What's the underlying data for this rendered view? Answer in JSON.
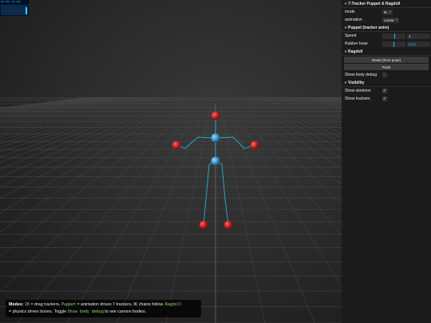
{
  "stats": {
    "text": "60 FPS (41-60)"
  },
  "gui": {
    "title": "7-Tracker Puppet & Ragdoll",
    "mode": {
      "label": "mode",
      "value": "IK"
    },
    "animation": {
      "label": "animation",
      "value": "Linear"
    },
    "puppet_section": {
      "title": "Puppet (tracker anim)"
    },
    "speed": {
      "label": "Speed",
      "value": "1",
      "level": 0.5
    },
    "rubber_hose": {
      "label": "Rubber hose",
      "value": "0.22",
      "level": 0.48
    },
    "ragdoll_section": {
      "title": "Ragdoll"
    },
    "reset_button": "Reset (from pose)",
    "push_button": "Push",
    "show_body_debug": {
      "label": "Show body debug",
      "checked": false
    },
    "visibility_section": {
      "title": "Visibility"
    },
    "show_skeleton": {
      "label": "Show skeleton",
      "checked": true
    },
    "show_trackers": {
      "label": "Show trackers",
      "checked": true
    }
  },
  "info": {
    "modes_label": "Modes:",
    "ik_code": "IK",
    "ik_text": " = drag trackers. ",
    "puppet_code": "Puppet",
    "puppet_text": " = animation drives 7 trackers, IK chains follow. ",
    "ragdoll_code": "Ragdoll",
    "ragdoll_text": "= physics drives bones. Toggle ",
    "debug_code": "Show body debug",
    "debug_text": " to see cannon bodies."
  },
  "colors": {
    "tracker": "#d42a2a",
    "joint": "#3a94c8",
    "skeleton": "#1fb5cf",
    "slider_accent": "#28a8e8",
    "code_green": "#8ee36a"
  }
}
